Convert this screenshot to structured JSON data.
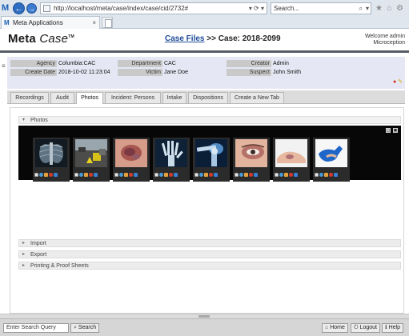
{
  "browser": {
    "url": "http://localhost/meta/case/index/case/cid/2732#",
    "search_placeholder": "Search...",
    "tab_title": "Meta Applications",
    "tab_close": "×",
    "app_letter": "M",
    "back_icon": "←",
    "forward_icon": "→",
    "url_tools": "▾ ⟳ ▾",
    "search_icon": "⌕",
    "search_dropdown": "▾",
    "star_icon": "★",
    "home_icon": "⌂",
    "settings_icon": "⚙",
    "smiley_icon": "☺"
  },
  "header": {
    "logo_meta": "Meta",
    "logo_case": "Case",
    "logo_tm": "TM",
    "breadcrumb_link": "Case Files",
    "breadcrumb_rest": " >> Case: 2018-2099",
    "welcome_line1": "Welcome admin",
    "welcome_line2": "Microception"
  },
  "case_info": {
    "agency_label": "Agency",
    "agency_value": "Columbia:CAC",
    "department_label": "Department",
    "department_value": "CAC",
    "creator_label": "Creator",
    "creator_value": "Admin",
    "create_date_label": "Create Date",
    "create_date_value": "2018-10-02 11:23:04",
    "victim_label": "Victim",
    "victim_value": "Jane Doe",
    "suspect_label": "Suspect",
    "suspect_value": "John Smith",
    "side_handle": "≡",
    "icon_minus": "●",
    "icon_edit": "✎"
  },
  "tabs": [
    {
      "label": "Recordings"
    },
    {
      "label": "Audit"
    },
    {
      "label": "Photos"
    },
    {
      "label": "Incident: Persons"
    },
    {
      "label": "Intake"
    },
    {
      "label": "Dispositions"
    },
    {
      "label": "Create a New Tab"
    }
  ],
  "active_tab": "Photos",
  "content": {
    "tools": "✎✉",
    "photos_section": "Photos",
    "gallery_tools": [
      "◻",
      "◼"
    ],
    "photos": [
      {
        "subject": "chest x-ray"
      },
      {
        "subject": "car accident scene"
      },
      {
        "subject": "bruised skin"
      },
      {
        "subject": "hand x-ray"
      },
      {
        "subject": "shoulder x-ray"
      },
      {
        "subject": "bruised eye"
      },
      {
        "subject": "bruised foot"
      },
      {
        "subject": "bruised hand in blue glove"
      }
    ],
    "collapsed_sections": [
      {
        "label": "Import"
      },
      {
        "label": "Export"
      },
      {
        "label": "Printing & Proof Sheets"
      }
    ],
    "expand_arrow": "▸",
    "collapse_arrow": "▾"
  },
  "bottom": {
    "search_placeholder": "Enter Search Query",
    "search_button": "Search",
    "home_button": "Home",
    "logout_button": "Logout",
    "help_button": "Help",
    "search_icon": "⌕",
    "home_icon": "⌂",
    "logout_icon": "⏻",
    "help_icon": "ℹ"
  }
}
